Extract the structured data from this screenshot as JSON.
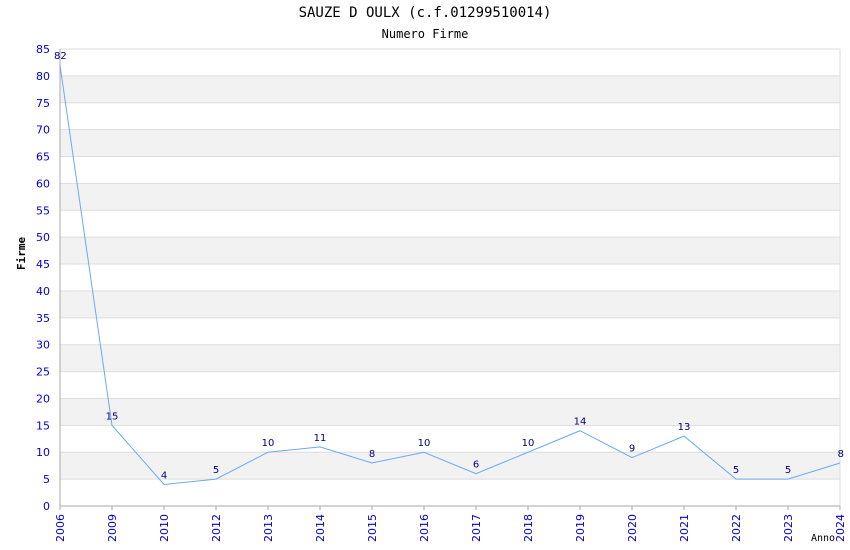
{
  "chart_data": {
    "type": "line",
    "title": "SAUZE D OULX (c.f.01299510014)",
    "subtitle": "Numero Firme",
    "xlabel": "Anno",
    "ylabel": "Firme",
    "categories": [
      "2006",
      "2009",
      "2010",
      "2012",
      "2013",
      "2014",
      "2015",
      "2016",
      "2017",
      "2018",
      "2019",
      "2020",
      "2021",
      "2022",
      "2023",
      "2024"
    ],
    "values": [
      82,
      15,
      4,
      5,
      10,
      11,
      8,
      10,
      6,
      10,
      14,
      9,
      13,
      5,
      5,
      8
    ],
    "ylim": [
      0,
      85
    ],
    "yticks": [
      0,
      5,
      10,
      15,
      20,
      25,
      30,
      35,
      40,
      45,
      50,
      55,
      60,
      65,
      70,
      75,
      80,
      85
    ],
    "grid": true,
    "colors": {
      "line": "#6aaaf0",
      "axis_text": "#0000cc",
      "label_text": "#000080",
      "band": "#f2f2f2",
      "gridline": "#dddddd"
    }
  }
}
